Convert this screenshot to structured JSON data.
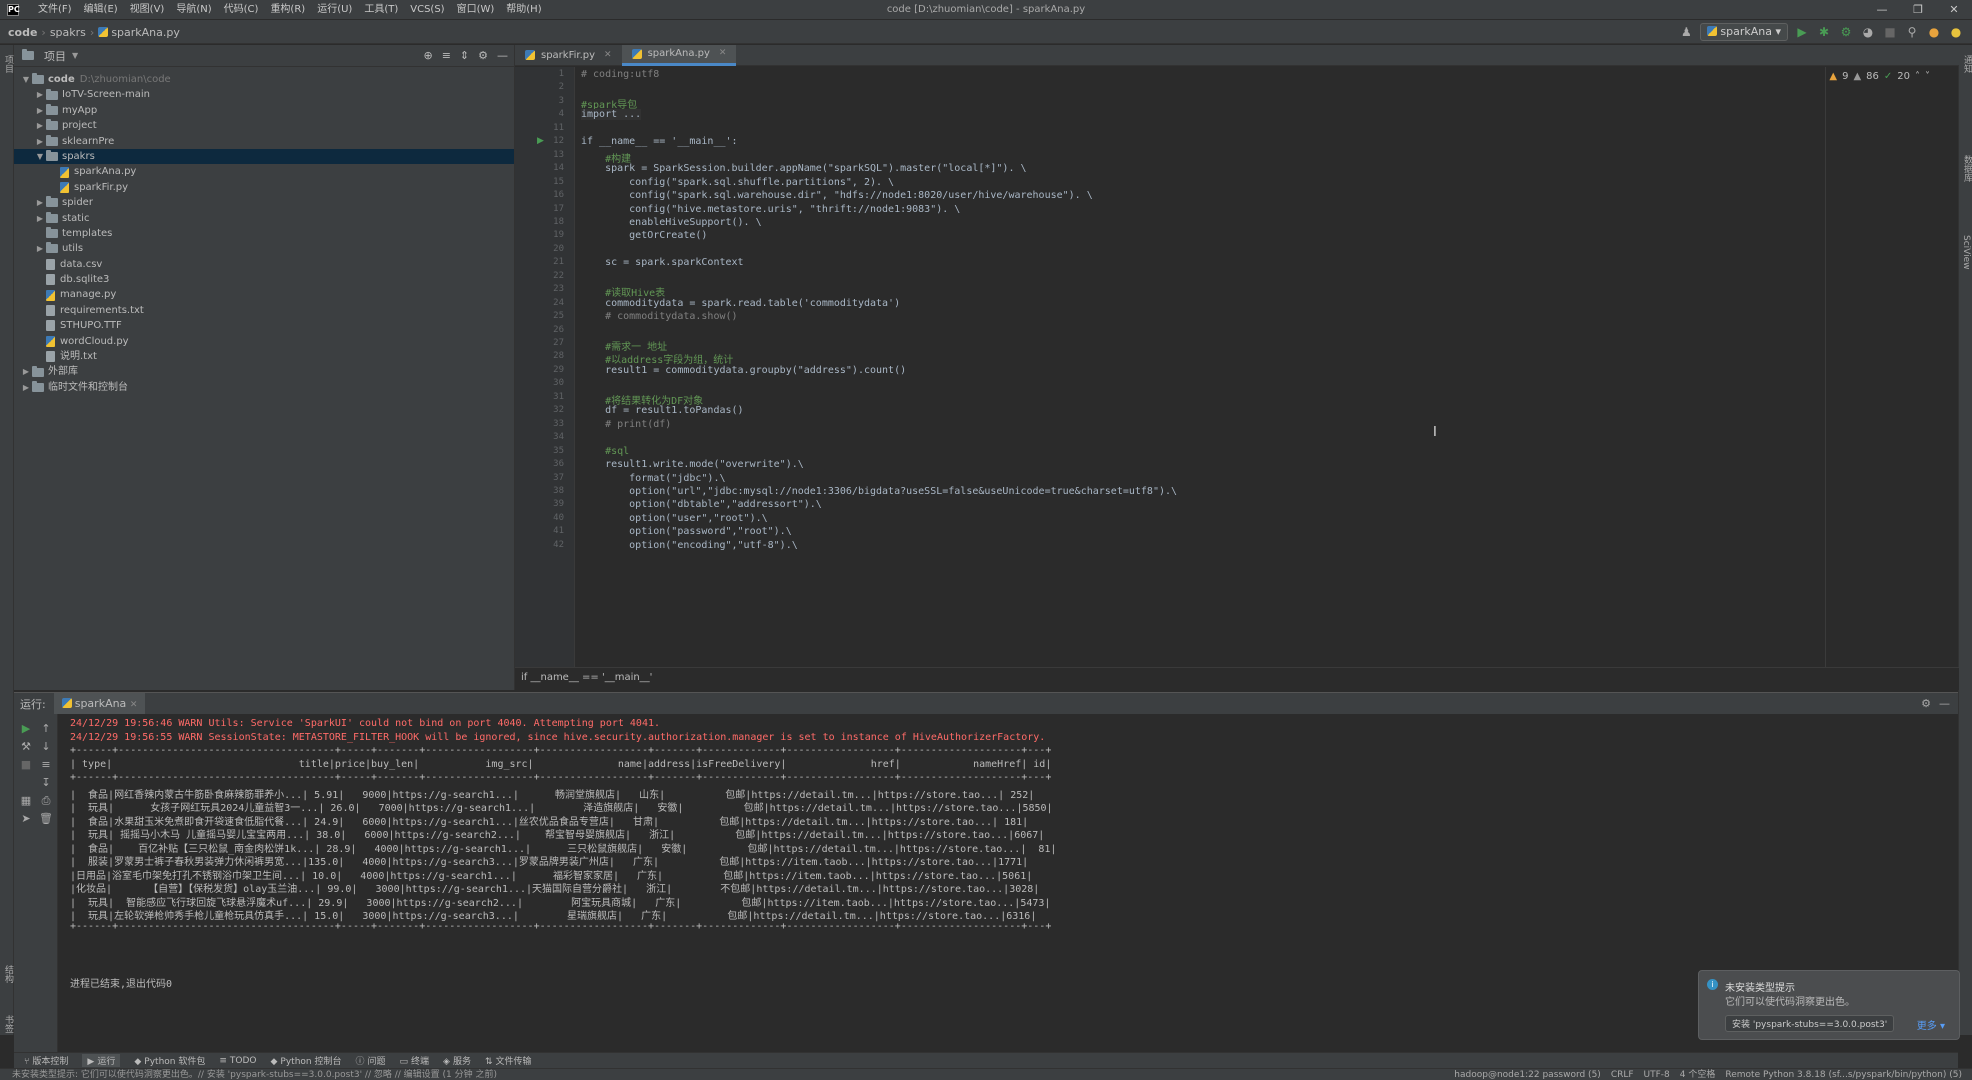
{
  "window": {
    "title": "code [D:\\zhuomian\\code] - sparkAna.py",
    "menu": [
      "文件(F)",
      "编辑(E)",
      "视图(V)",
      "导航(N)",
      "代码(C)",
      "重构(R)",
      "运行(U)",
      "工具(T)",
      "VCS(S)",
      "窗口(W)",
      "帮助(H)"
    ]
  },
  "navbar": {
    "breadcrumb": [
      "code",
      "spakrs",
      "sparkAna.py"
    ],
    "run_config": "sparkAna"
  },
  "project": {
    "header": "项目",
    "tree": [
      {
        "level": 0,
        "type": "folder",
        "open": true,
        "label": "code",
        "path": "D:\\zhuomian\\code"
      },
      {
        "level": 1,
        "type": "folder",
        "open": false,
        "label": "IoTV-Screen-main"
      },
      {
        "level": 1,
        "type": "folder",
        "open": false,
        "label": "myApp"
      },
      {
        "level": 1,
        "type": "folder",
        "open": false,
        "label": "project"
      },
      {
        "level": 1,
        "type": "folder",
        "open": false,
        "label": "sklearnPre"
      },
      {
        "level": 1,
        "type": "folder",
        "open": true,
        "label": "spakrs",
        "selected": true
      },
      {
        "level": 2,
        "type": "py",
        "label": "sparkAna.py"
      },
      {
        "level": 2,
        "type": "py",
        "label": "sparkFir.py"
      },
      {
        "level": 1,
        "type": "folder",
        "open": false,
        "label": "spider"
      },
      {
        "level": 1,
        "type": "folder",
        "open": false,
        "label": "static"
      },
      {
        "level": 1,
        "type": "folder",
        "open": null,
        "label": "templates"
      },
      {
        "level": 1,
        "type": "folder",
        "open": false,
        "label": "utils"
      },
      {
        "level": 1,
        "type": "file",
        "label": "data.csv"
      },
      {
        "level": 1,
        "type": "file",
        "label": "db.sqlite3"
      },
      {
        "level": 1,
        "type": "py",
        "label": "manage.py"
      },
      {
        "level": 1,
        "type": "file",
        "label": "requirements.txt"
      },
      {
        "level": 1,
        "type": "file",
        "label": "STHUPO.TTF"
      },
      {
        "level": 1,
        "type": "py",
        "label": "wordCloud.py"
      },
      {
        "level": 1,
        "type": "file",
        "label": "说明.txt"
      },
      {
        "level": 0,
        "type": "folder",
        "open": false,
        "label": "外部库"
      },
      {
        "level": 0,
        "type": "folder",
        "open": false,
        "label": "临时文件和控制台"
      }
    ]
  },
  "editor": {
    "tabs": [
      {
        "label": "sparkFir.py",
        "active": false
      },
      {
        "label": "sparkAna.py",
        "active": true
      }
    ],
    "inspection": {
      "warnings": "9",
      "weak": "86",
      "typos": "20"
    },
    "line_numbers": [
      "1",
      "2",
      "3",
      "4",
      "11",
      "12",
      "13",
      "14",
      "15",
      "16",
      "17",
      "18",
      "19",
      "20",
      "21",
      "22",
      "23",
      "24",
      "25",
      "26",
      "27",
      "28",
      "29",
      "30",
      "31",
      "32",
      "33",
      "34",
      "35",
      "36",
      "37",
      "38",
      "39",
      "40",
      "41",
      "42"
    ],
    "lines": [
      {
        "text": "# coding:utf8",
        "style": "comment"
      },
      {
        "text": "",
        "style": ""
      },
      {
        "text": "#spark导包",
        "style": "cn-comment"
      },
      {
        "text": "import ...",
        "style": "highlight"
      },
      {
        "text": "",
        "style": ""
      },
      {
        "text": "if __name__ == '__main__':",
        "style": ""
      },
      {
        "text": "    #构建",
        "style": "cn-comment"
      },
      {
        "text": "    spark = SparkSession.builder.appName(\"sparkSQL\").master(\"local[*]\"). \\",
        "style": ""
      },
      {
        "text": "        config(\"spark.sql.shuffle.partitions\", 2). \\",
        "style": ""
      },
      {
        "text": "        config(\"spark.sql.warehouse.dir\", \"hdfs://node1:8020/user/hive/warehouse\"). \\",
        "style": ""
      },
      {
        "text": "        config(\"hive.metastore.uris\", \"thrift://node1:9083\"). \\",
        "style": ""
      },
      {
        "text": "        enableHiveSupport(). \\",
        "style": ""
      },
      {
        "text": "        getOrCreate()",
        "style": ""
      },
      {
        "text": "",
        "style": ""
      },
      {
        "text": "    sc = spark.sparkContext",
        "style": ""
      },
      {
        "text": "",
        "style": ""
      },
      {
        "text": "    #读取Hive表",
        "style": "cn-comment"
      },
      {
        "text": "    commoditydata = spark.read.table('commoditydata')",
        "style": ""
      },
      {
        "text": "    # commoditydata.show()",
        "style": "comment"
      },
      {
        "text": "",
        "style": ""
      },
      {
        "text": "    #需求一 地址",
        "style": "cn-comment"
      },
      {
        "text": "    #以address字段为组，统计",
        "style": "cn-comment"
      },
      {
        "text": "    result1 = commoditydata.groupby(\"address\").count()",
        "style": ""
      },
      {
        "text": "",
        "style": ""
      },
      {
        "text": "    #将结果转化为DF对象",
        "style": "cn-comment"
      },
      {
        "text": "    df = result1.toPandas()",
        "style": ""
      },
      {
        "text": "    # print(df)",
        "style": "comment"
      },
      {
        "text": "",
        "style": ""
      },
      {
        "text": "    #sql",
        "style": "cn-comment"
      },
      {
        "text": "    result1.write.mode(\"overwrite\").\\",
        "style": ""
      },
      {
        "text": "        format(\"jdbc\").\\",
        "style": ""
      },
      {
        "text": "        option(\"url\",\"jdbc:mysql://node1:3306/bigdata?useSSL=false&useUnicode=true&charset=utf8\").\\",
        "style": ""
      },
      {
        "text": "        option(\"dbtable\",\"addressort\").\\",
        "style": ""
      },
      {
        "text": "        option(\"user\",\"root\").\\",
        "style": ""
      },
      {
        "text": "        option(\"password\",\"root\").\\",
        "style": ""
      },
      {
        "text": "        option(\"encoding\",\"utf-8\").\\",
        "style": ""
      }
    ],
    "breadcrumb": "if __name__ == '__main__'"
  },
  "run": {
    "label": "运行:",
    "tab": "sparkAna",
    "console": [
      {
        "text": "24/12/29 19:56:46 WARN Utils: Service 'SparkUI' could not bind on port 4040. Attempting port 4041.",
        "style": "warn"
      },
      {
        "text": "24/12/29 19:56:55 WARN SessionState: METASTORE_FILTER_HOOK will be ignored, since hive.security.authorization.manager is set to instance of HiveAuthorizerFactory.",
        "style": "warn"
      },
      {
        "text": "+------+------------------------------------+-----+-------+------------------+------------------+-------+-------------+------------------+--------------------+---+",
        "style": ""
      },
      {
        "text": "| type|                               title|price|buy_len|           img_src|              name|address|isFreeDelivery|              href|            nameHref| id|",
        "style": ""
      },
      {
        "text": "+------+------------------------------------+-----+-------+------------------+------------------+-------+-------------+------------------+--------------------+---+",
        "style": ""
      },
      {
        "text": "|  食品|网红香辣内蒙古牛筋卧食麻辣筋罪养小...| 5.91|   9000|https://g-search1...|      畅润堂旗舰店|   山东|          包邮|https://detail.tm...|https://store.tao...| 252|",
        "style": ""
      },
      {
        "text": "|  玩具|      女孩子网红玩具2024儿童益智3一...| 26.0|   7000|https://g-search1...|        泽造旗舰店|   安徽|          包邮|https://detail.tm...|https://store.tao...|5850|",
        "style": ""
      },
      {
        "text": "|  食品|水果甜玉米免煮即食开袋速食低脂代餐...| 24.9|   6000|https://g-search1...|丝农优品食品专营店|   甘肃|          包邮|https://detail.tm...|https://store.tao...| 181|",
        "style": ""
      },
      {
        "text": "|  玩具| 摇摇马小木马 儿童摇马婴儿宝宝两用...| 38.0|   6000|https://g-search2...|    帮宝智母婴旗舰店|   浙江|          包邮|https://detail.tm...|https://store.tao...|6067|",
        "style": ""
      },
      {
        "text": "|  食品|    百亿补贴【三只松鼠_南金肉松饼1k...| 28.9|   4000|https://g-search1...|      三只松鼠旗舰店|   安徽|          包邮|https://detail.tm...|https://store.tao...|  81|",
        "style": ""
      },
      {
        "text": "|  服装|罗蒙男士裤子春秋男装弹力休闲裤男宽...|135.0|   4000|https://g-search3...|罗蒙品牌男装广州店|   广东|          包邮|https://item.taob...|https://store.tao...|1771|",
        "style": ""
      },
      {
        "text": "|日用品|浴室毛巾架免打孔不锈钢浴巾架卫生间...| 10.0|   4000|https://g-search1...|      福彩智家家居|   广东|          包邮|https://item.taob...|https://store.tao...|5061|",
        "style": ""
      },
      {
        "text": "|化妆品|      【自营】【保税发货】olay玉兰油...| 99.0|   3000|https://g-search1...|天猫国际自营分爵社|   浙江|        不包邮|https://detail.tm...|https://store.tao...|3028|",
        "style": ""
      },
      {
        "text": "|  玩具|  智能感应飞行球回旋飞球悬浮魔术uf...| 29.9|   3000|https://g-search2...|        阿宝玩具商城|   广东|          包邮|https://item.taob...|https://store.tao...|5473|",
        "style": ""
      },
      {
        "text": "|  玩具|左轮软弹枪帅秀手枪儿童枪玩具仿真手...| 15.0|   3000|https://g-search3...|        星瑞旗舰店|   广东|          包邮|https://detail.tm...|https://store.tao...|6316|",
        "style": ""
      },
      {
        "text": "+------+------------------------------------+-----+-------+------------------+------------------+-------+-------------+------------------+--------------------+---+",
        "style": ""
      },
      {
        "text": "",
        "style": ""
      },
      {
        "text": "",
        "style": ""
      },
      {
        "text": "",
        "style": ""
      },
      {
        "text": "进程已结束,退出代码0",
        "style": ""
      }
    ]
  },
  "notification": {
    "title": "未安装类型提示",
    "text": "它们可以使代码洞察更出色。",
    "action": "安装 'pyspark-stubs==3.0.0.post3'",
    "more": "更多"
  },
  "tool_tabs": [
    "版本控制",
    "运行",
    "Python 软件包",
    "TODO",
    "Python 控制台",
    "问题",
    "终端",
    "服务",
    "文件传输"
  ],
  "status": {
    "left": "未安装类型提示: 它们可以使代码洞察更出色。// 安装 'pyspark-stubs==3.0.0.post3' // 忽略 // 编辑设置 (1 分钟 之前)",
    "items": [
      "hadoop@node1:22 password (5)",
      "CRLF",
      "UTF-8",
      "4 个空格",
      "Remote Python 3.8.18 (sf...s/pyspark/bin/python) (5)"
    ]
  },
  "colors": {
    "accent": "#4a88c7",
    "warning_text": "#ff6b68",
    "link": "#5394ec",
    "comment_cn": "#629755"
  }
}
